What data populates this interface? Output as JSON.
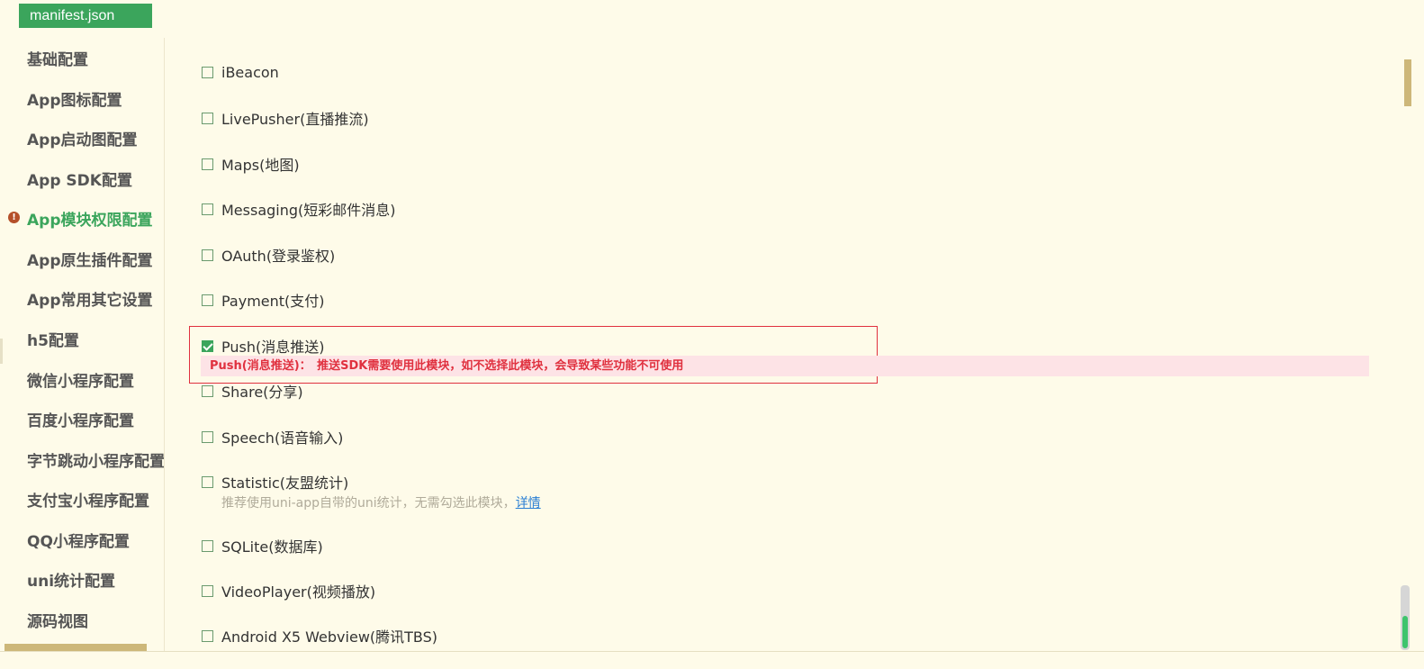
{
  "tab": {
    "label": "manifest.json"
  },
  "sidebar": {
    "items": [
      {
        "label": "基础配置",
        "active": false
      },
      {
        "label": "App图标配置",
        "active": false
      },
      {
        "label": "App启动图配置",
        "active": false
      },
      {
        "label": "App SDK配置",
        "active": false
      },
      {
        "label": "App模块权限配置",
        "active": true
      },
      {
        "label": "App原生插件配置",
        "active": false
      },
      {
        "label": "App常用其它设置",
        "active": false
      },
      {
        "label": "h5配置",
        "active": false
      },
      {
        "label": "微信小程序配置",
        "active": false
      },
      {
        "label": "百度小程序配置",
        "active": false
      },
      {
        "label": "字节跳动小程序配置",
        "active": false
      },
      {
        "label": "支付宝小程序配置",
        "active": false
      },
      {
        "label": "QQ小程序配置",
        "active": false
      },
      {
        "label": "uni统计配置",
        "active": false
      },
      {
        "label": "源码视图",
        "active": false
      }
    ],
    "warning_glyph": "!"
  },
  "modules": [
    {
      "label": "iBeacon",
      "checked": false
    },
    {
      "label": "LivePusher(直播推流)",
      "checked": false
    },
    {
      "label": "Maps(地图)",
      "checked": false
    },
    {
      "label": "Messaging(短彩邮件消息)",
      "checked": false
    },
    {
      "label": "OAuth(登录鉴权)",
      "checked": false
    },
    {
      "label": "Payment(支付)",
      "checked": false
    },
    {
      "label": "Push(消息推送)",
      "checked": true
    },
    {
      "label": "Share(分享)",
      "checked": false
    },
    {
      "label": "Speech(语音输入)",
      "checked": false
    },
    {
      "label": "Statistic(友盟统计)",
      "checked": false
    },
    {
      "label": "SQLite(数据库)",
      "checked": false
    },
    {
      "label": "VideoPlayer(视频播放)",
      "checked": false
    },
    {
      "label": "Android X5 Webview(腾讯TBS)",
      "checked": false
    }
  ],
  "push_banner": "Push(消息推送)：　推送SDK需要使用此模块，如不选择此模块，会导致某些功能不可使用",
  "statistic_note": {
    "text": "推荐使用uni-app自带的uni统计，无需勾选此模块，",
    "link": "详情"
  },
  "colors": {
    "accent": "#3ba55c",
    "error": "#e0313f",
    "background": "#fefbe9"
  }
}
